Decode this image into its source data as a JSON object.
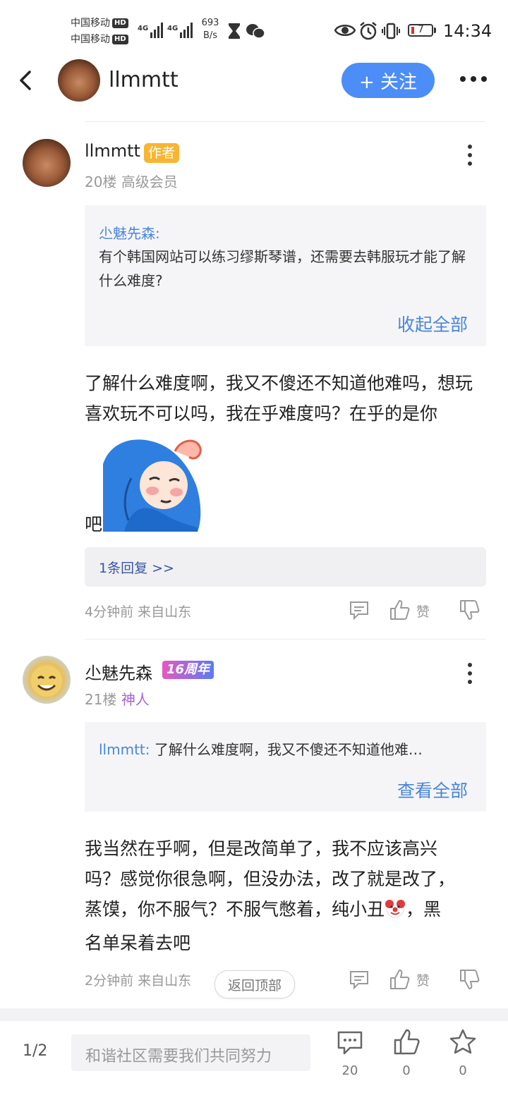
{
  "status_bar": {
    "carrier1": "中国移动",
    "carrier2": "中国移动",
    "hd": "HD",
    "sig1_label": "4G",
    "sig2_label": "4G",
    "speed_value": "693",
    "speed_unit": "B/s",
    "battery": "7",
    "time": "14:34"
  },
  "header": {
    "username": "llmmtt",
    "follow_label": "+ 关注"
  },
  "posts": [
    {
      "username": "llmmtt",
      "badge": "作者",
      "floor": "20楼",
      "rank": "高级会员",
      "quote": {
        "author": "尐魅先森:",
        "text": "有个韩国网站可以练习缪斯琴谱，还需要去韩服玩才能了解什么难度?",
        "toggle": "收起全部"
      },
      "body": "了解什么难度啊，我又不傻还不知道他难吗，想玩喜欢玩不可以吗，我在乎难度吗？在乎的是你",
      "body_tail": "吧",
      "reply_link": "1条回复 >>",
      "time": "4分钟前 来自山东",
      "like_label": "赞"
    },
    {
      "username": "尐魅先森",
      "badge": "16周年",
      "floor": "21楼",
      "rank": "神人",
      "quote": {
        "author": "llmmtt:",
        "text": "了解什么难度啊，我又不傻还不知道他难…",
        "toggle": "查看全部"
      },
      "body_line1": "我当然在乎啊，但是改简单了，我不应该高兴",
      "body_line2": "吗？感觉你很急啊，但没办法，改了就是改了，",
      "body_line3a": "蒸馍，你不服气？不服气憋着，纯小丑",
      "body_line3b": "，黑",
      "body_line4": "名单呆着去吧",
      "time": "2分钟前 来自山东",
      "like_label": "赞"
    }
  ],
  "back_to_top": "返回顶部",
  "bottom_bar": {
    "page": "1/2",
    "input_placeholder": "和谐社区需要我们共同努力",
    "comment_count": "20",
    "like_count": "0",
    "fav_count": "0"
  }
}
